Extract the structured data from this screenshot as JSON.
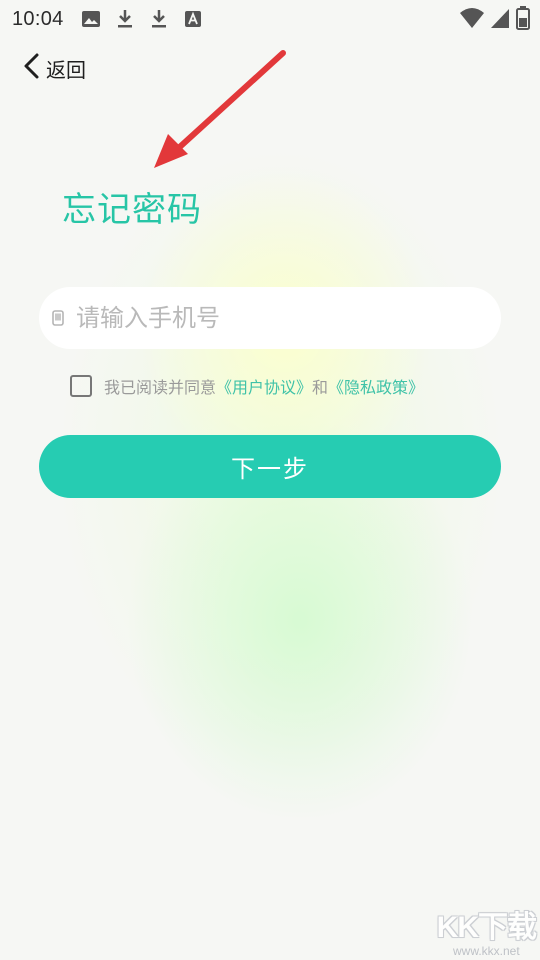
{
  "status_bar": {
    "time": "10:04",
    "left_icons": [
      "image-icon",
      "download-icon",
      "download-icon",
      "font-icon"
    ],
    "right_icons": [
      "wifi-icon",
      "signal-icon",
      "battery-icon"
    ]
  },
  "nav": {
    "back_label": "返回"
  },
  "title": "忘记密码",
  "phone": {
    "placeholder": "请输入手机号",
    "value": ""
  },
  "agreement": {
    "checked": false,
    "prefix": "我已阅读并同意",
    "user_agreement": "《用户协议》",
    "conjunction": "和",
    "privacy_policy": "《隐私政策》"
  },
  "next_button": "下一步",
  "watermark": {
    "logo": "KK下载",
    "url": "www.kkx.net"
  },
  "colors": {
    "accent": "#27c5a6",
    "button": "#26ccb2",
    "annotation_arrow": "#e2383a"
  }
}
